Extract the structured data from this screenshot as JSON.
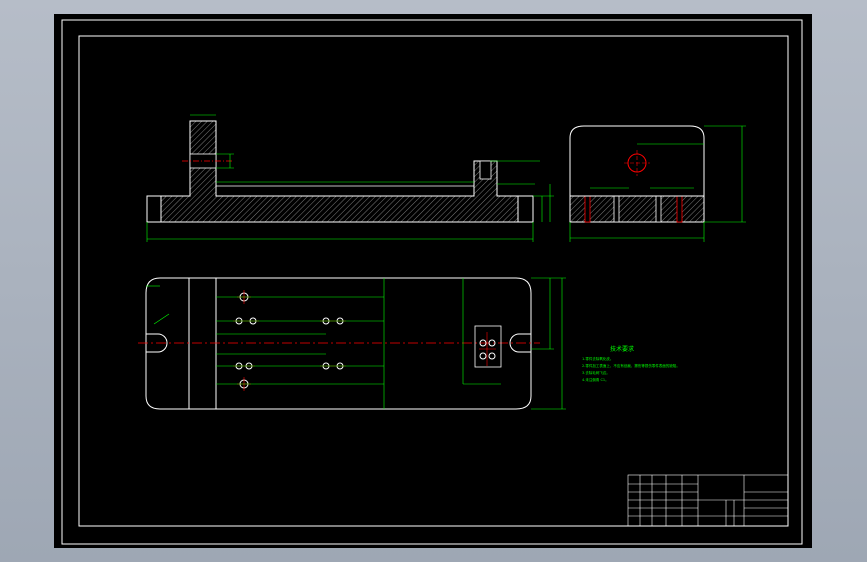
{
  "viewer": {
    "background": "#000000",
    "frame_color": "#ffffff"
  },
  "colors": {
    "outline": "#ffffff",
    "dimension": "#00ff00",
    "centerline": "#ff0000",
    "hatch": "#b0b0b0",
    "note_text": "#00ff00"
  },
  "views": {
    "front_section": {
      "name": "front section view"
    },
    "side_section": {
      "name": "side section view"
    },
    "top_view": {
      "name": "top view"
    }
  },
  "technical_requirements": {
    "heading": "技术要求",
    "lines": [
      "1.零件去除氧化皮。",
      "2.零件加工表面上，不应有划痕、擦伤等损伤零件表面的缺陷。",
      "3.去除毛刺飞边。",
      "4.未注倒角 C1。"
    ]
  },
  "title_block": {
    "name": "title block"
  }
}
